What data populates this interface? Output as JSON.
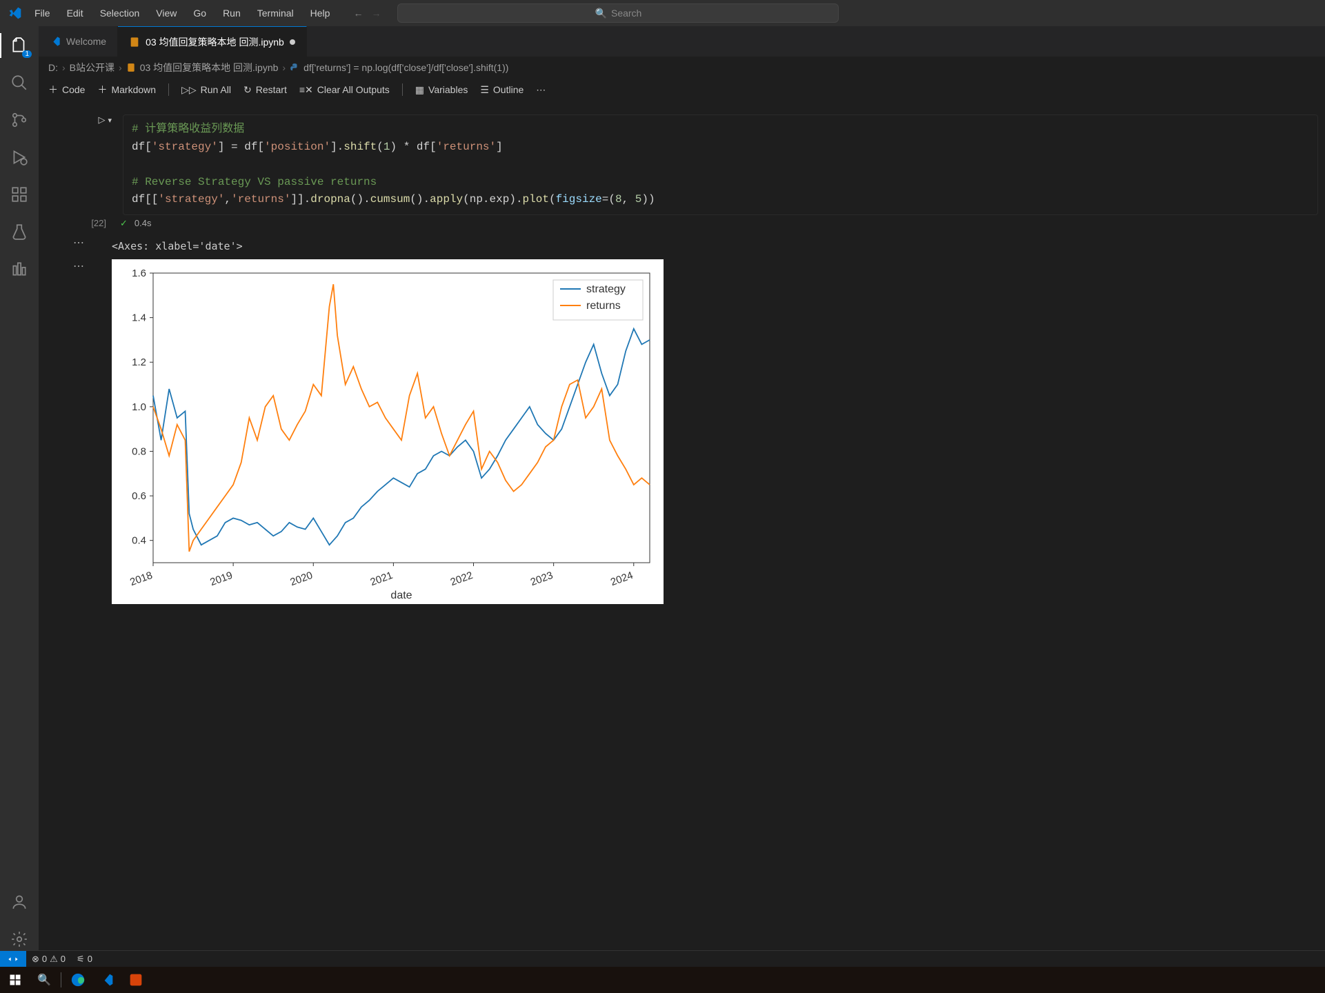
{
  "menu": {
    "file": "File",
    "edit": "Edit",
    "selection": "Selection",
    "view": "View",
    "go": "Go",
    "run": "Run",
    "terminal": "Terminal",
    "help": "Help"
  },
  "search": {
    "placeholder": "Search"
  },
  "activitybar": {
    "badge": "1"
  },
  "tabs": {
    "welcome": "Welcome",
    "file": "03 均值回复策略本地 回测.ipynb"
  },
  "breadcrumb": {
    "drive": "D:",
    "folder": "B站公开课",
    "file": "03 均值回复策略本地 回测.ipynb",
    "cell": "df['returns'] = np.log(df['close']/df['close'].shift(1))"
  },
  "toolbar": {
    "code": "Code",
    "markdown": "Markdown",
    "runall": "Run All",
    "restart": "Restart",
    "clear": "Clear All Outputs",
    "variables": "Variables",
    "outline": "Outline"
  },
  "cell": {
    "exec_count": "[22]",
    "exec_time": "0.4s",
    "comment1": "# 计算策略收益列数据",
    "comment2": "# Reverse Strategy VS passive returns"
  },
  "output": {
    "axes_repr": "<Axes: xlabel='date'>"
  },
  "chart_data": {
    "type": "line",
    "xlabel": "date",
    "ylabel": "",
    "xlim": [
      2018,
      2024.2
    ],
    "ylim": [
      0.3,
      1.6
    ],
    "x_ticks": [
      2018,
      2019,
      2020,
      2021,
      2022,
      2023,
      2024
    ],
    "y_ticks": [
      0.4,
      0.6,
      0.8,
      1.0,
      1.2,
      1.4,
      1.6
    ],
    "legend": [
      "strategy",
      "returns"
    ],
    "colors": {
      "strategy": "#1f77b4",
      "returns": "#ff7f0e"
    },
    "x": [
      2018.0,
      2018.1,
      2018.2,
      2018.3,
      2018.4,
      2018.45,
      2018.5,
      2018.6,
      2018.7,
      2018.8,
      2018.9,
      2019.0,
      2019.1,
      2019.2,
      2019.3,
      2019.4,
      2019.5,
      2019.6,
      2019.7,
      2019.8,
      2019.9,
      2020.0,
      2020.1,
      2020.2,
      2020.25,
      2020.3,
      2020.4,
      2020.5,
      2020.6,
      2020.7,
      2020.8,
      2020.9,
      2021.0,
      2021.1,
      2021.2,
      2021.3,
      2021.4,
      2021.5,
      2021.6,
      2021.7,
      2021.8,
      2021.9,
      2022.0,
      2022.1,
      2022.2,
      2022.3,
      2022.4,
      2022.5,
      2022.6,
      2022.7,
      2022.8,
      2022.9,
      2023.0,
      2023.1,
      2023.2,
      2023.3,
      2023.4,
      2023.5,
      2023.6,
      2023.7,
      2023.8,
      2023.9,
      2024.0,
      2024.1,
      2024.2
    ],
    "series": [
      {
        "name": "strategy",
        "values": [
          1.05,
          0.85,
          1.08,
          0.95,
          0.98,
          0.52,
          0.45,
          0.38,
          0.4,
          0.42,
          0.48,
          0.5,
          0.49,
          0.47,
          0.48,
          0.45,
          0.42,
          0.44,
          0.48,
          0.46,
          0.45,
          0.5,
          0.44,
          0.38,
          0.4,
          0.42,
          0.48,
          0.5,
          0.55,
          0.58,
          0.62,
          0.65,
          0.68,
          0.66,
          0.64,
          0.7,
          0.72,
          0.78,
          0.8,
          0.78,
          0.82,
          0.85,
          0.8,
          0.68,
          0.72,
          0.78,
          0.85,
          0.9,
          0.95,
          1.0,
          0.92,
          0.88,
          0.85,
          0.9,
          1.0,
          1.1,
          1.2,
          1.28,
          1.15,
          1.05,
          1.1,
          1.25,
          1.35,
          1.28,
          1.3
        ]
      },
      {
        "name": "returns",
        "values": [
          1.0,
          0.9,
          0.78,
          0.92,
          0.85,
          0.35,
          0.4,
          0.45,
          0.5,
          0.55,
          0.6,
          0.65,
          0.75,
          0.95,
          0.85,
          1.0,
          1.05,
          0.9,
          0.85,
          0.92,
          0.98,
          1.1,
          1.05,
          1.45,
          1.55,
          1.32,
          1.1,
          1.18,
          1.08,
          1.0,
          1.02,
          0.95,
          0.9,
          0.85,
          1.05,
          1.15,
          0.95,
          1.0,
          0.88,
          0.78,
          0.85,
          0.92,
          0.98,
          0.72,
          0.8,
          0.75,
          0.67,
          0.62,
          0.65,
          0.7,
          0.75,
          0.82,
          0.85,
          1.0,
          1.1,
          1.12,
          0.95,
          1.0,
          1.08,
          0.85,
          0.78,
          0.72,
          0.65,
          0.68,
          0.65
        ]
      }
    ]
  },
  "statusbar": {
    "errors": "0",
    "warnings": "0",
    "ports": "0"
  }
}
